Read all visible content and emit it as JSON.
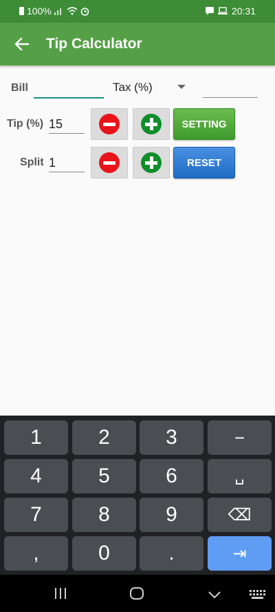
{
  "status_bar": {
    "battery": "100%",
    "time": "20:31"
  },
  "app_bar": {
    "title": "Tip Calculator"
  },
  "form": {
    "bill_label": "Bill",
    "bill_value": "",
    "tax_label": "Tax (%)",
    "tax_value": "",
    "tip_label": "Tip (%)",
    "tip_value": "15",
    "split_label": "Split",
    "split_value": "1",
    "setting_label": "SETTING",
    "reset_label": "RESET"
  },
  "keyboard": {
    "rows": [
      [
        "1",
        "2",
        "3",
        "−"
      ],
      [
        "4",
        "5",
        "6",
        "␣"
      ],
      [
        "7",
        "8",
        "9",
        "⌫"
      ],
      [
        ",",
        "0",
        ".",
        "⇥"
      ]
    ]
  },
  "colors": {
    "status_bar": "#3d8c36",
    "app_bar": "#55a046",
    "setting_button": "#4fa83a",
    "reset_button": "#2d7fd6",
    "minus_icon": "#e8141a",
    "plus_icon": "#0f8e2b",
    "enter_key": "#5f9df5"
  }
}
